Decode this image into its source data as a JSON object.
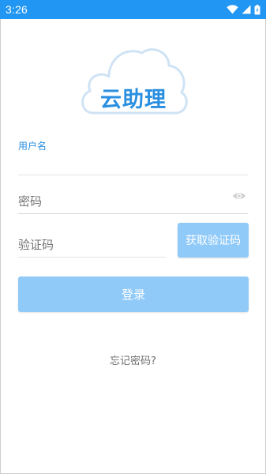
{
  "status_bar": {
    "time": "3:26",
    "icons": [
      "wifi-icon",
      "cell-signal-icon",
      "battery-icon"
    ],
    "color": "#2196f3"
  },
  "logo": {
    "text": "云助理",
    "color": "#2b8fe0"
  },
  "form": {
    "username_label": "用户名",
    "username_value": "",
    "password_placeholder": "密码",
    "code_placeholder": "验证码",
    "get_code_label": "获取验证码",
    "login_label": "登录",
    "forgot_label": "忘记密码?"
  },
  "colors": {
    "accent": "#2b8fe0",
    "button_disabled": "#90caf9"
  }
}
